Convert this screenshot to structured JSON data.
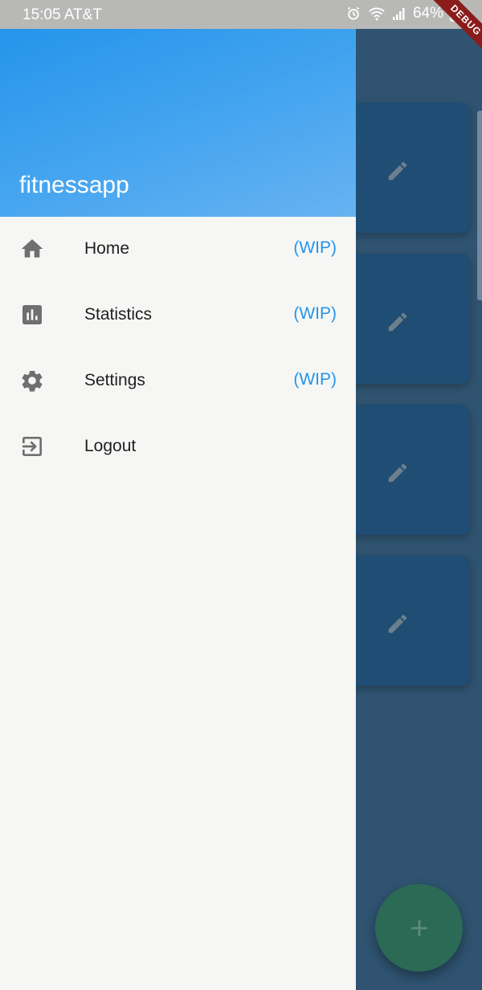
{
  "status_bar": {
    "time_carrier": "15:05 AT&T",
    "battery": "64%",
    "icons": [
      "alarm-icon",
      "wifi-icon",
      "signal-icon",
      "battery-icon"
    ]
  },
  "debug_banner": "DEBUG",
  "drawer": {
    "title": "fitnessapp",
    "items": [
      {
        "label": "Home",
        "badge": "(WIP)",
        "icon": "home-icon"
      },
      {
        "label": "Statistics",
        "badge": "(WIP)",
        "icon": "bar-chart-icon"
      },
      {
        "label": "Settings",
        "badge": "(WIP)",
        "icon": "gear-icon"
      },
      {
        "label": "Logout",
        "badge": "",
        "icon": "logout-icon"
      }
    ]
  },
  "colors": {
    "header_gradient_start": "#2594ea",
    "header_gradient_end": "#67b3f1",
    "accent": "#2594ea",
    "fab": "#2b6a55",
    "card": "#1f4d73"
  },
  "background_cards": [
    {
      "icon": "edit-icon"
    },
    {
      "icon": "edit-icon"
    },
    {
      "icon": "edit-icon"
    },
    {
      "icon": "edit-icon"
    }
  ],
  "fab": {
    "icon": "add-icon"
  }
}
